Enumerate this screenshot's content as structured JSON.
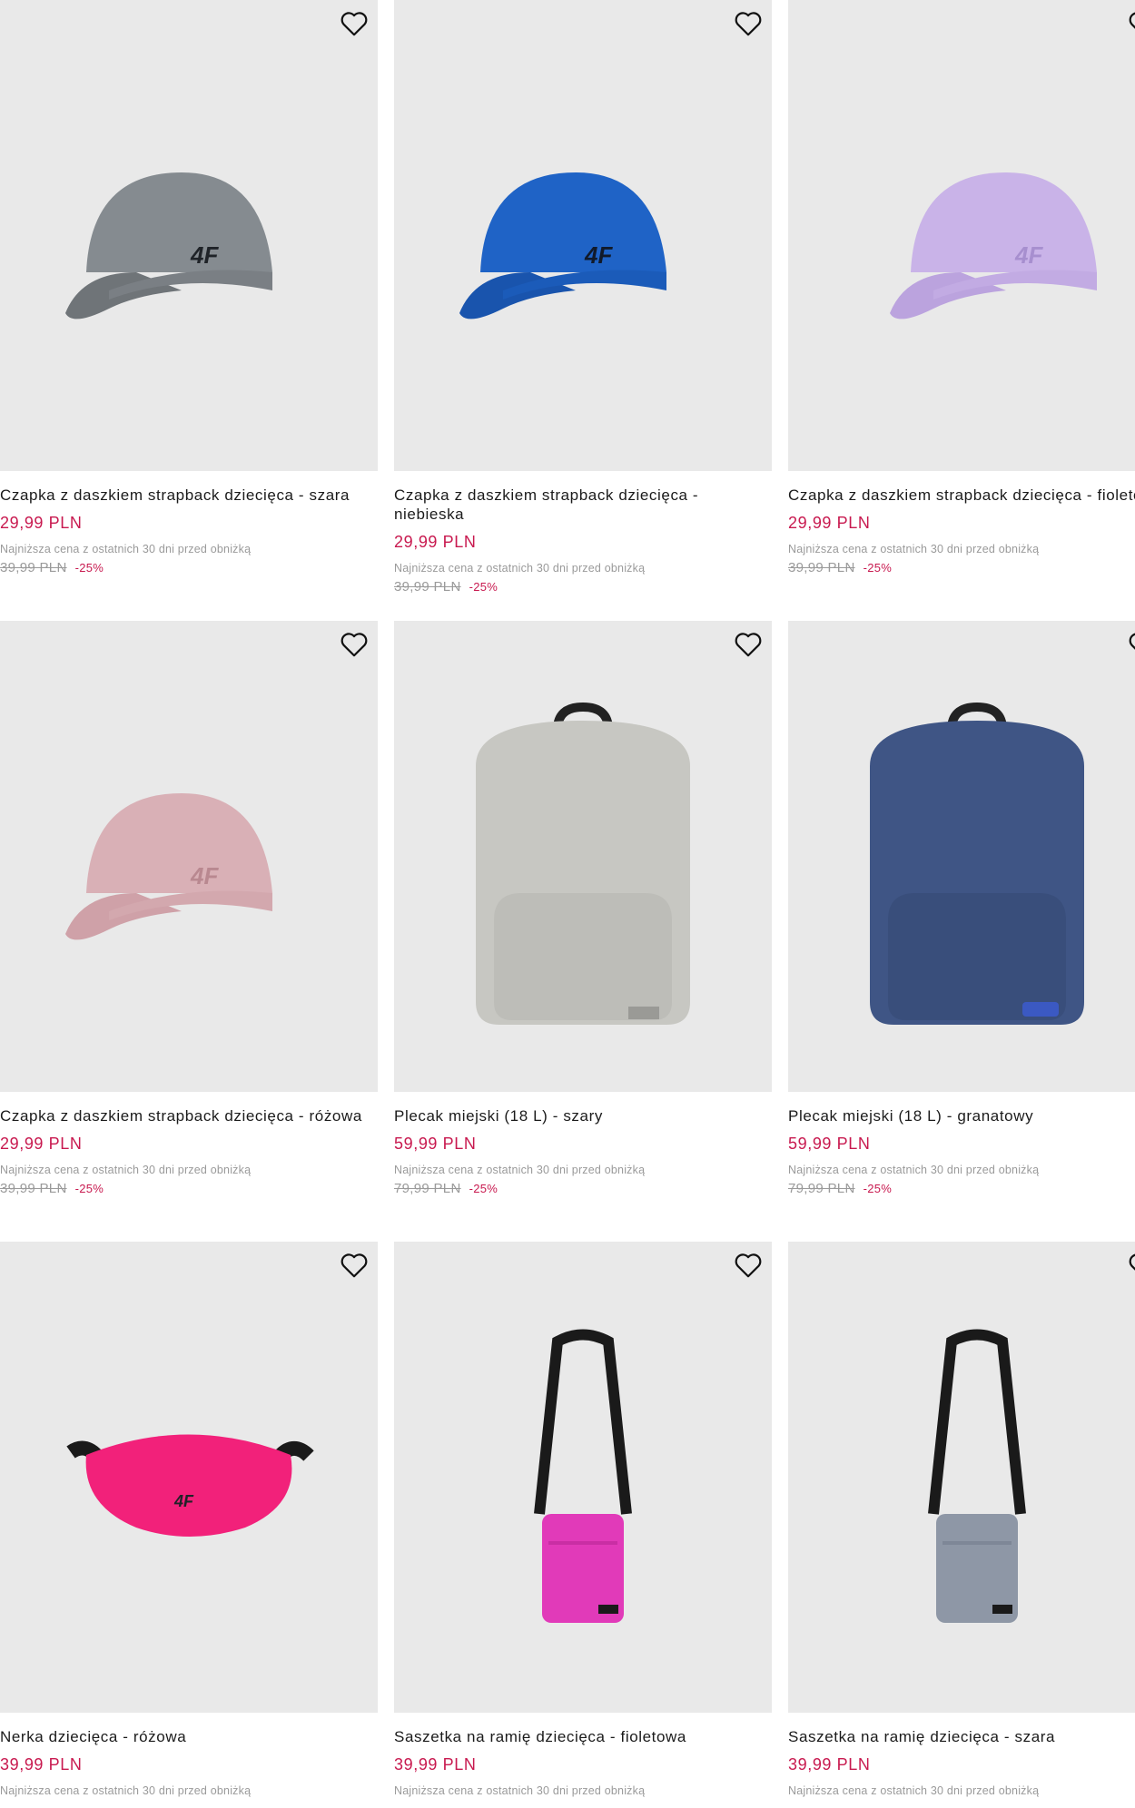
{
  "products": [
    {
      "name": "Czapka z daszkiem strapback dziecięca - szara",
      "price": "29,99 PLN",
      "lowest_label": "Najniższa cena z ostatnich 30 dni przed obniżką",
      "old_price": "39,99 PLN",
      "discount": "-25%",
      "image": "cap",
      "color": "#858b90"
    },
    {
      "name": "Czapka z daszkiem strapback dziecięca - niebieska",
      "price": "29,99 PLN",
      "lowest_label": "Najniższa cena z ostatnich 30 dni przed obniżką",
      "old_price": "39,99 PLN",
      "discount": "-25%",
      "image": "cap",
      "color": "#1f63c6"
    },
    {
      "name": "Czapka z daszkiem strapback dziecięca - fioletowa",
      "price": "29,99 PLN",
      "lowest_label": "Najniższa cena z ostatnich 30 dni przed obniżką",
      "old_price": "39,99 PLN",
      "discount": "-25%",
      "image": "cap",
      "color": "#c9b3e8"
    },
    {
      "name": "Czapka z daszkiem strapback dziecięca - różowa",
      "price": "29,99 PLN",
      "lowest_label": "Najniższa cena z ostatnich 30 dni przed obniżką",
      "old_price": "39,99 PLN",
      "discount": "-25%",
      "image": "cap",
      "color": "#d9b0b6"
    },
    {
      "name": "Plecak miejski (18 L) - szary",
      "price": "59,99 PLN",
      "lowest_label": "Najniższa cena z ostatnich 30 dni przed obniżką",
      "old_price": "79,99 PLN",
      "discount": "-25%",
      "image": "backpack",
      "color": "#c7c7c2"
    },
    {
      "name": "Plecak miejski (18 L) - granatowy",
      "price": "59,99 PLN",
      "lowest_label": "Najniższa cena z ostatnich 30 dni przed obniżką",
      "old_price": "79,99 PLN",
      "discount": "-25%",
      "image": "backpack",
      "color": "#3f5585"
    },
    {
      "name": "Nerka dziecięca - różowa",
      "price": "39,99 PLN",
      "lowest_label": "Najniższa cena z ostatnich 30 dni przed obniżką",
      "old_price": "",
      "discount": "",
      "image": "waistbag",
      "color": "#f2217a"
    },
    {
      "name": "Saszetka na ramię dziecięca - fioletowa",
      "price": "39,99 PLN",
      "lowest_label": "Najniższa cena z ostatnich 30 dni przed obniżką",
      "old_price": "",
      "discount": "",
      "image": "shoulderbag",
      "color": "#e13ab9"
    },
    {
      "name": "Saszetka na ramię dziecięca - szara",
      "price": "39,99 PLN",
      "lowest_label": "Najniższa cena z ostatnich 30 dni przed obniżką",
      "old_price": "",
      "discount": "",
      "image": "shoulderbag",
      "color": "#8e97a6"
    }
  ]
}
